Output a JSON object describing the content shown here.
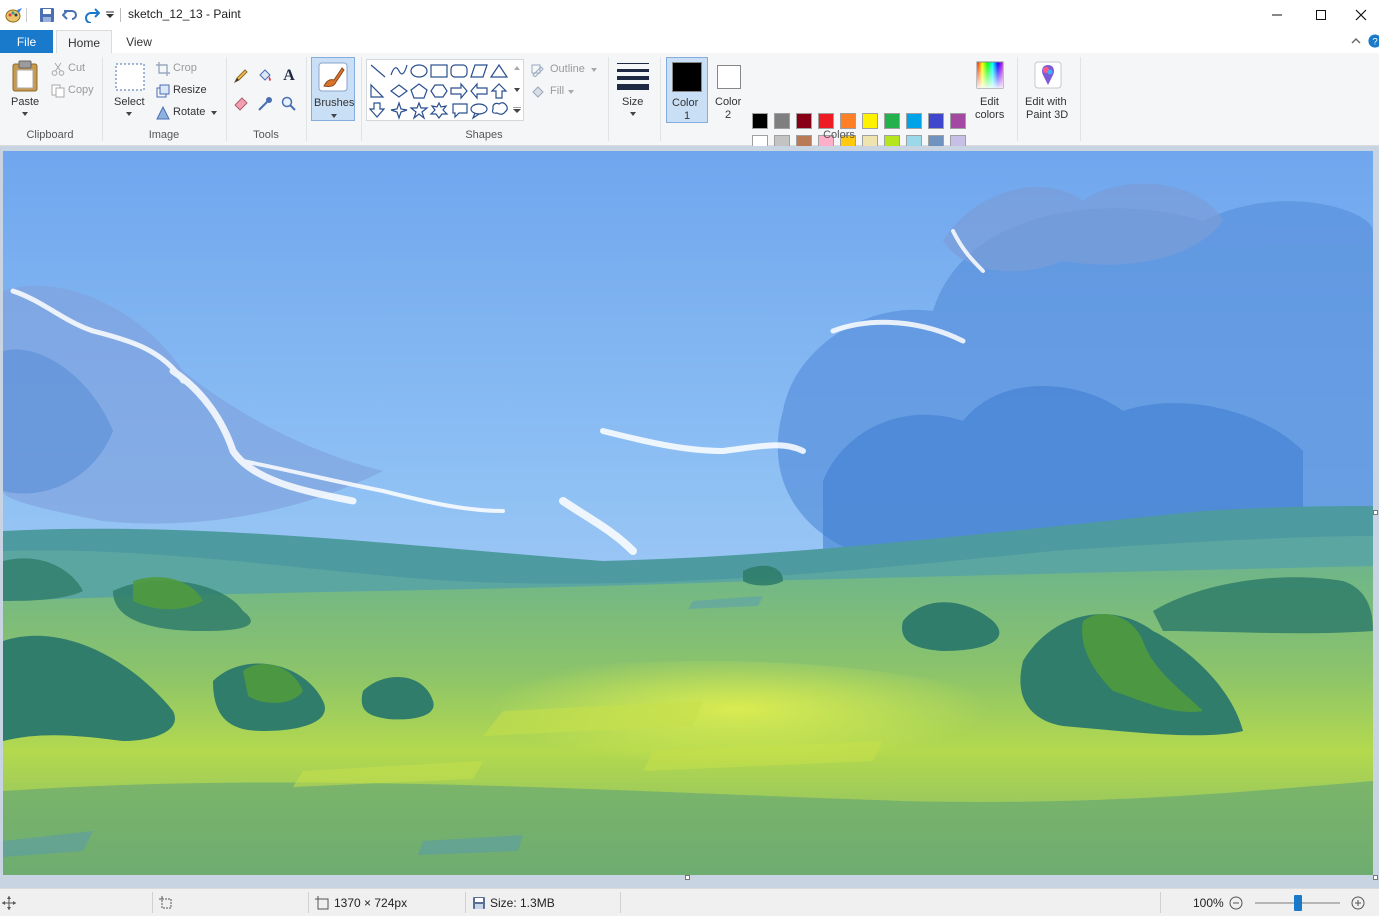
{
  "window": {
    "title": "sketch_12_13 - Paint"
  },
  "tabs": {
    "file": "File",
    "home": "Home",
    "view": "View"
  },
  "ribbon": {
    "clipboard": {
      "paste": "Paste",
      "cut": "Cut",
      "copy": "Copy",
      "group": "Clipboard"
    },
    "image": {
      "select": "Select",
      "crop": "Crop",
      "resize": "Resize",
      "rotate": "Rotate",
      "group": "Image"
    },
    "tools": {
      "group": "Tools",
      "text_glyph": "A"
    },
    "brushes": {
      "label": "Brushes"
    },
    "shapes": {
      "outline": "Outline",
      "fill": "Fill",
      "group": "Shapes"
    },
    "size": {
      "label": "Size"
    },
    "colors": {
      "color1_line1": "Color",
      "color1_line2": "1",
      "color2_line1": "Color",
      "color2_line2": "2",
      "edit_line1": "Edit",
      "edit_line2": "colors",
      "group": "Colors",
      "color1_value": "#000000",
      "color2_value": "#ffffff",
      "palette_row1": [
        "#000000",
        "#7f7f7f",
        "#880015",
        "#ed1c24",
        "#ff7f27",
        "#fff200",
        "#22b14c",
        "#00a2e8",
        "#3f48cc",
        "#a349a4"
      ],
      "palette_row2": [
        "#ffffff",
        "#c3c3c3",
        "#b97a57",
        "#ffaec9",
        "#ffc90e",
        "#efe4b0",
        "#b5e61d",
        "#99d9ea",
        "#7092be",
        "#c8bfe7"
      ]
    },
    "paint3d": {
      "line1": "Edit with",
      "line2": "Paint 3D"
    }
  },
  "status": {
    "dimensions": "1370 × 724px",
    "size": "Size: 1.3MB",
    "zoom": "100%",
    "zoom_level": 1.0
  },
  "icons": {
    "accent": "#1979ca"
  }
}
